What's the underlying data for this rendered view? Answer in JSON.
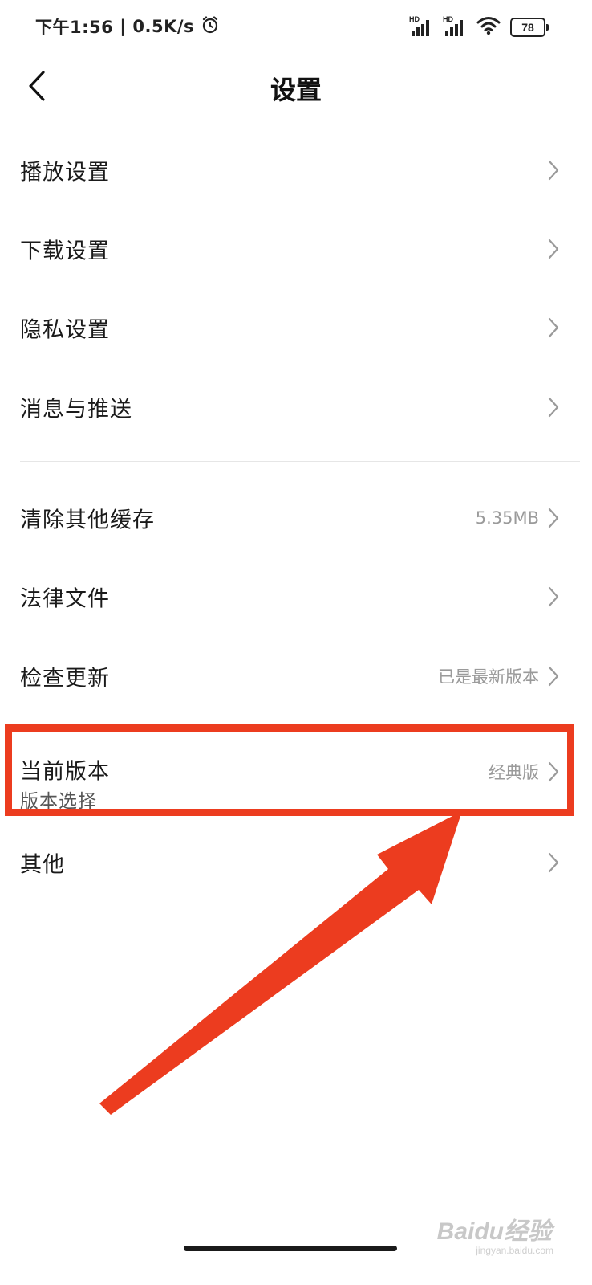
{
  "status_bar": {
    "time": "下午1:56",
    "separator": "|",
    "net_speed": "0.5K/s",
    "signal1_label": "HD",
    "signal2_label": "HD",
    "battery": "78"
  },
  "header": {
    "title": "设置"
  },
  "settings_group_1": [
    {
      "label": "播放设置"
    },
    {
      "label": "下载设置"
    },
    {
      "label": "隐私设置"
    },
    {
      "label": "消息与推送"
    }
  ],
  "settings_group_2": {
    "clear_cache": {
      "label": "清除其他缓存",
      "value": "5.35MB"
    },
    "legal": {
      "label": "法律文件"
    },
    "check_update": {
      "label": "检查更新",
      "value": "已是最新版本"
    },
    "current_version": {
      "label": "当前版本",
      "sublabel": "版本选择",
      "value": "经典版"
    },
    "other": {
      "label": "其他"
    }
  },
  "annotation": {
    "color": "#ec3c1f"
  },
  "watermark": {
    "text": "Baidu经验",
    "sub": "jingyan.baidu.com"
  },
  "icons": {
    "back": "back-arrow-icon",
    "chevron": "chevron-right-icon",
    "alarm": "alarm-icon",
    "wifi": "wifi-icon",
    "signal": "signal-icon",
    "battery": "battery-icon"
  }
}
